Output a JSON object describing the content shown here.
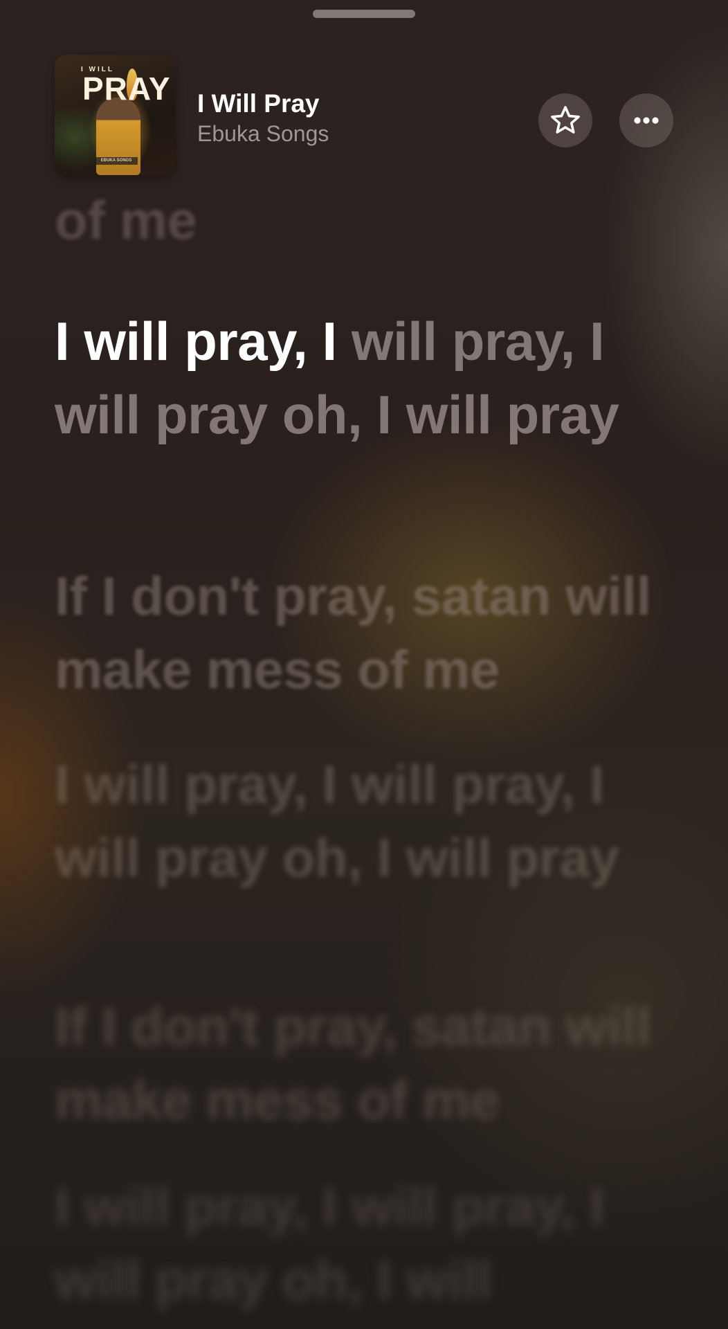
{
  "colors": {
    "background": "#241c1b",
    "sung_text": "#ffffff",
    "unsung_text": "#9c8e8c"
  },
  "header": {
    "album_art": {
      "small_text": "I WILL",
      "big_text": "PRAY",
      "label_text": "EBUKA SONGS"
    },
    "title": "I Will Pray",
    "artist": "Ebuka Songs",
    "favorite_icon": "star-icon",
    "more_icon": "ellipsis-icon"
  },
  "lyrics": {
    "previous": "of me",
    "current": {
      "sung": "I will pray, I ",
      "unsung": "will pray, I will pray oh, I will pray"
    },
    "upcoming": [
      "If I don't pray, satan will make mess of me",
      "I will pray, I will pray, I will pray oh, I will pray",
      "If I don't pray, satan will make mess of me",
      "I will pray, I will pray, I will pray oh, I will"
    ]
  }
}
